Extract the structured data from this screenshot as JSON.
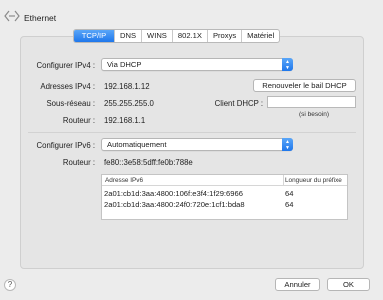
{
  "header": {
    "title": "Ethernet"
  },
  "tabs": [
    {
      "label": "TCP/IP",
      "active": true
    },
    {
      "label": "DNS"
    },
    {
      "label": "WINS"
    },
    {
      "label": "802.1X"
    },
    {
      "label": "Proxys"
    },
    {
      "label": "Matériel"
    }
  ],
  "ipv4": {
    "config_label": "Configurer IPv4 :",
    "config_value": "Via DHCP",
    "address_label": "Adresses IPv4 :",
    "address_value": "192.168.1.12",
    "subnet_label": "Sous-réseau :",
    "subnet_value": "255.255.255.0",
    "router_label": "Routeur :",
    "router_value": "192.168.1.1",
    "renew_button": "Renouveler le bail DHCP",
    "dhcp_client_label": "Client DHCP :",
    "dhcp_client_value": "",
    "dhcp_hint": "(si besoin)"
  },
  "ipv6": {
    "config_label": "Configurer IPv6 :",
    "config_value": "Automatiquement",
    "router_label": "Routeur :",
    "router_value": "fe80::3e58:5dff:fe0b:788e",
    "table": {
      "col_address": "Adresse IPv6",
      "col_prefix": "Longueur du préfixe",
      "rows": [
        {
          "address": "2a01:cb1d:3aa:4800:106f:e3f4:1f29:6966",
          "prefix": "64"
        },
        {
          "address": "2a01:cb1d:3aa:4800:24f0:720e:1cf1:bda8",
          "prefix": "64"
        }
      ]
    }
  },
  "footer": {
    "help": "?",
    "cancel": "Annuler",
    "ok": "OK"
  },
  "colors": {
    "accent": "#1f77ec",
    "background": "#ececec"
  }
}
